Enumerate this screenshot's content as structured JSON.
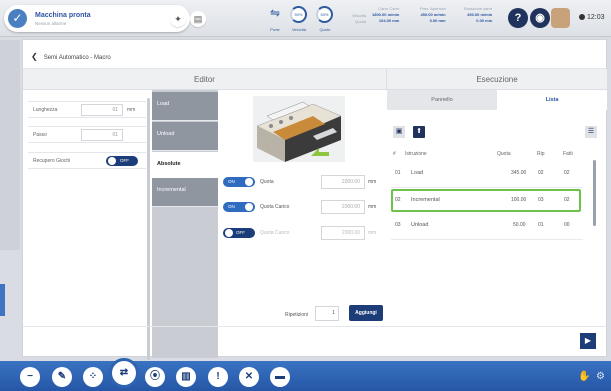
{
  "status": {
    "title": "Macchina pronta",
    "subtitle": "Nessun allarme"
  },
  "toolbar": {
    "tools": [
      {
        "label": "Porte",
        "icon": "door-icon"
      },
      {
        "label": "Velocità",
        "icon": "speed-gauge-icon",
        "value": "50%"
      },
      {
        "label": "Quote",
        "icon": "quote-gauge-icon",
        "value": "50%"
      }
    ],
    "stats_col1": [
      "Velocità",
      "Quota"
    ],
    "stats_col2_header": "Carro Carro",
    "stats_col2": [
      "1800.00 m/min",
      "104.00 mm"
    ],
    "stats_col3_header": "Pres. Apertura",
    "stats_col3": [
      "450.00 m/min",
      "0.00 mm"
    ],
    "stats_col4_header": "Rotazione carro",
    "stats_col4": [
      "450.00 m/min",
      "0.00 mm"
    ],
    "clock": "12:03"
  },
  "breadcrumb": "Semi Automatico - Macro",
  "editor": {
    "title": "Editor",
    "fields": [
      {
        "label": "Lunghezza",
        "value": "01",
        "unit": "mm"
      },
      {
        "label": "Passo",
        "value": "01",
        "unit": ""
      }
    ],
    "toggle_field": {
      "label": "Recupero Giochi",
      "state": "OFF"
    },
    "tabs": [
      "Load",
      "Unload",
      "Absolute",
      "Incremental"
    ],
    "params": [
      {
        "toggle": "ON",
        "label": "Quota",
        "value": "2000.00",
        "unit": "mm"
      },
      {
        "toggle": "ON",
        "label": "Quota Carico",
        "value": "2000.00",
        "unit": "mm"
      },
      {
        "toggle": "OFF",
        "label": "Quota Carico",
        "value": "2000.00",
        "unit": "mm"
      }
    ],
    "repetitions_label": "Ripetizioni",
    "repetitions_value": "1",
    "add_label": "Aggiungi"
  },
  "execution": {
    "title": "Esecuzione",
    "tabs": [
      "Pannello",
      "Lista"
    ],
    "columns": [
      "#",
      "Istruzione",
      "Quota",
      "Rip",
      "Fatti"
    ],
    "rows": [
      {
        "n": "01",
        "instr": "Load",
        "quota": "345.00",
        "rip": "02",
        "fatti": "02"
      },
      {
        "n": "02",
        "instr": "Incremental",
        "quota": "100.00",
        "rip": "03",
        "fatti": "02"
      },
      {
        "n": "03",
        "instr": "Unload",
        "quota": "50.00",
        "rip": "01",
        "fatti": "00"
      }
    ]
  },
  "colors": {
    "accent": "#1c3d78",
    "selected_row_border": "#6cc24a",
    "bottom_bar": "#2e63b2"
  }
}
